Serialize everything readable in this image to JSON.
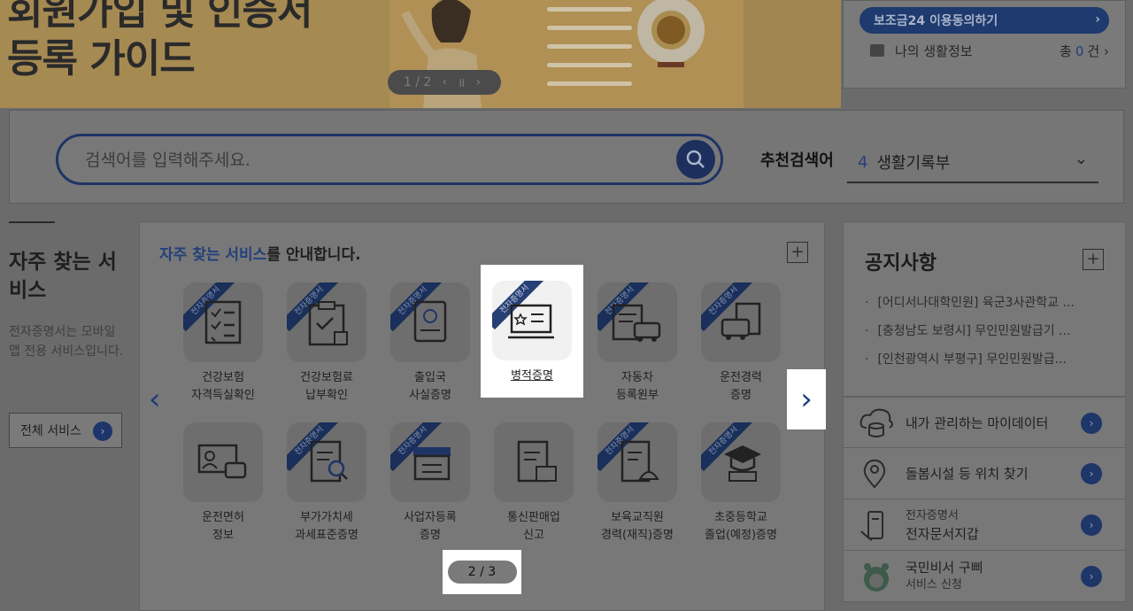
{
  "banner": {
    "title_line1": "회원가입 및 인증서",
    "title_line2": "등록 가이드",
    "slide_counter": "1 / 2"
  },
  "user_panel": {
    "bojo_button": "보조금24 이용동의하기",
    "my_life": "나의 생활정보",
    "count_prefix": "총",
    "count_value": "0",
    "count_suffix": "건"
  },
  "search": {
    "placeholder": "검색어를 입력해주세요.",
    "recommend_label": "추천검색어",
    "recommend_rank": "4",
    "recommend_term": "생활기록부"
  },
  "left": {
    "title": "자주 찾는 서비스",
    "description": "전자증명서는 모바일 앱 전용 서비스입니다.",
    "all_services": "전체 서비스"
  },
  "services": {
    "heading_highlight": "자주 찾는 서비스",
    "heading_rest": "를 안내합니다.",
    "ribbon": "전자증명서",
    "page_indicator": "2 / 3",
    "row1": [
      {
        "line1": "건강보험",
        "line2": "자격득실확인",
        "icon": "checklist-icon"
      },
      {
        "line1": "건강보험료",
        "line2": "납부확인",
        "icon": "clipboard-stamp-icon"
      },
      {
        "line1": "출입국",
        "line2": "사실증명",
        "icon": "passport-icon"
      },
      {
        "line1": "병적증명",
        "line2": "",
        "icon": "military-id-icon"
      },
      {
        "line1": "자동차",
        "line2": "등록원부",
        "icon": "car-document-icon"
      },
      {
        "line1": "운전경력",
        "line2": "증명",
        "icon": "car-license-icon"
      }
    ],
    "row2": [
      {
        "line1": "운전면허",
        "line2": "정보",
        "icon": "driver-license-icon"
      },
      {
        "line1": "부가가치세",
        "line2": "과세표준증명",
        "icon": "tax-search-icon"
      },
      {
        "line1": "사업자등록",
        "line2": "증명",
        "icon": "store-icon"
      },
      {
        "line1": "통신판매업",
        "line2": "신고",
        "icon": "online-store-doc-icon"
      },
      {
        "line1": "보육교직원",
        "line2": "경력(재직)증명",
        "icon": "childcare-doc-icon"
      },
      {
        "line1": "초중등학교",
        "line2": "졸업(예정)증명",
        "icon": "graduation-icon"
      }
    ]
  },
  "notice": {
    "title": "공지사항",
    "items": [
      "[어디서나대학민원] 육군3사관학교 ...",
      "[충청남도 보령시] 무인민원발급기 ...",
      "[인천광역시 부평구] 무인민원발급..."
    ]
  },
  "quick_links": [
    {
      "label": "내가 관리하는 마이데이터",
      "sub": "",
      "icon": "cloud-database-icon"
    },
    {
      "label": "돌봄시설 등 위치 찾기",
      "sub": "",
      "icon": "location-pin-icon"
    },
    {
      "label": "전자문서지갑",
      "sub": "전자증명서",
      "icon": "mobile-document-icon"
    },
    {
      "label": "국민비서 구삐",
      "sub": "서비스 신청",
      "icon": "gubbi-mascot-icon"
    }
  ],
  "colors": {
    "brand_navy": "#1e3668",
    "highlight_text": "#22407a"
  }
}
